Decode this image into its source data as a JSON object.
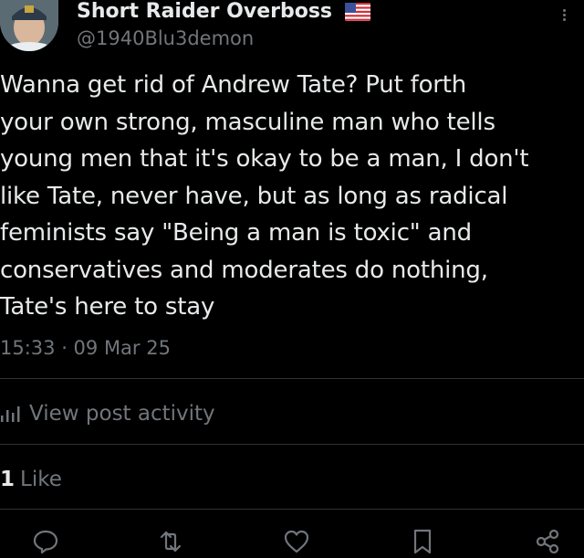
{
  "author": {
    "display_name": "Short Raider Overboss",
    "flag_emoji": "us-flag",
    "handle": "@1940Blu3demon"
  },
  "post": {
    "text": "Wanna get rid of Andrew Tate? Put forth\nyour own strong, masculine man who tells\nyoung men that it's okay to be a man, I don't\nlike Tate, never have, but as long as radical\nfeminists say \"Being a man is toxic\" and\nconservatives and moderates do nothing,\nTate's here to stay",
    "timestamp": "15:33 · 09 Mar 25"
  },
  "activity": {
    "label": "View post activity",
    "icon": "bar-chart-icon"
  },
  "engagement": {
    "likes_count": "1",
    "likes_label": "Like"
  },
  "actions": [
    {
      "name": "reply",
      "icon": "reply-icon"
    },
    {
      "name": "repost",
      "icon": "repost-icon"
    },
    {
      "name": "like",
      "icon": "heart-icon"
    },
    {
      "name": "bookmark",
      "icon": "bookmark-icon"
    },
    {
      "name": "share",
      "icon": "share-icon"
    }
  ],
  "colors": {
    "background": "#000000",
    "text_primary": "#e7e9ea",
    "text_secondary": "#71767b",
    "divider": "#2f3336"
  }
}
